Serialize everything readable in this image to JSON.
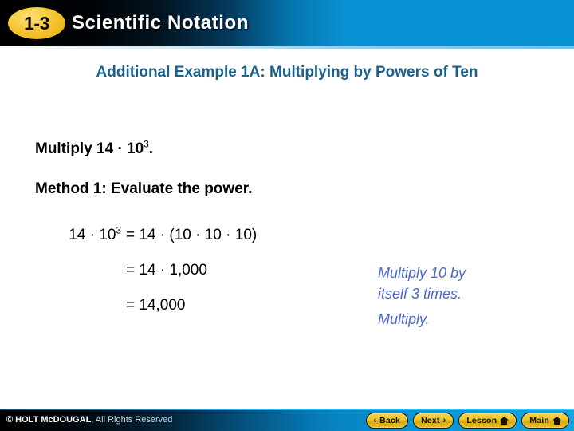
{
  "header": {
    "badge_label": "1-3",
    "title": "Scientific Notation",
    "badge_color": "#f0c42b",
    "title_color": "#ffffff",
    "gradient_start": "#000000",
    "gradient_end": "#0891d3"
  },
  "slide": {
    "subtitle": "Additional Example 1A: Multiplying by Powers of Ten",
    "subtitle_color": "#17618d",
    "problem": {
      "prefix": "Multiply 14 · 10",
      "exponent": "3",
      "suffix": "."
    },
    "method": "Method 1: Evaluate the power.",
    "equations": [
      {
        "lhs_base": "14 · 10",
        "lhs_exp": "3",
        "rhs": "= 14 · (10 · 10 · 10)"
      },
      {
        "lhs_base": "",
        "lhs_exp": "",
        "rhs": "= 14 · 1,000"
      },
      {
        "lhs_base": "",
        "lhs_exp": "",
        "rhs": "= 14,000"
      }
    ],
    "annotations": [
      "Multiply 10 by",
      "itself 3 times.",
      "Multiply."
    ],
    "annotation_color": "#4a69c8"
  },
  "footer": {
    "copyright_bold": "© HOLT McDOUGAL",
    "copyright_rest": ", All Rights Reserved",
    "buttons": [
      {
        "label": "Back",
        "icon": "chevron-left-icon",
        "glyph": "‹",
        "icon_side": "left"
      },
      {
        "label": "Next",
        "icon": "chevron-right-icon",
        "glyph": "›",
        "icon_side": "right"
      },
      {
        "label": "Lesson",
        "icon": "home-icon",
        "glyph": "",
        "icon_side": "right"
      },
      {
        "label": "Main",
        "icon": "home-icon",
        "glyph": "",
        "icon_side": "right"
      }
    ],
    "button_color": "#f0c42b"
  }
}
